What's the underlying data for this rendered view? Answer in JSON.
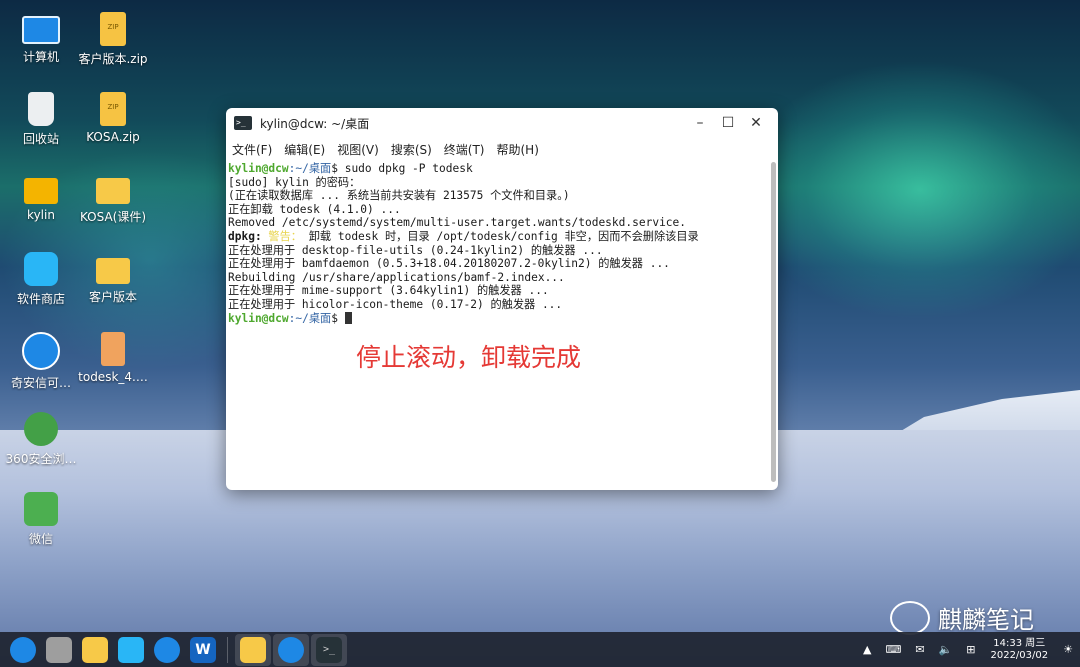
{
  "desktop_icons": [
    {
      "id": "computer",
      "label": "计算机",
      "icon": "computer-icon"
    },
    {
      "id": "trash",
      "label": "回收站",
      "icon": "trash-icon"
    },
    {
      "id": "kylin",
      "label": "kylin",
      "icon": "home-folder-icon"
    },
    {
      "id": "store",
      "label": "软件商店",
      "icon": "store-icon"
    },
    {
      "id": "qax",
      "label": "奇安信可…",
      "icon": "browser-icon"
    },
    {
      "id": "360",
      "label": "360安全浏…",
      "icon": "360-browser-icon"
    },
    {
      "id": "wechat",
      "label": "微信",
      "icon": "wechat-icon"
    },
    {
      "id": "clientzip",
      "label": "客户版本.zip",
      "icon": "zip-icon"
    },
    {
      "id": "kosazip",
      "label": "KOSA.zip",
      "icon": "zip-icon"
    },
    {
      "id": "kosafolder",
      "label": "KOSA(课件)",
      "icon": "folder-icon"
    },
    {
      "id": "clientfolder",
      "label": "客户版本",
      "icon": "folder-icon"
    },
    {
      "id": "todesk",
      "label": "todesk_4.…",
      "icon": "deb-package-icon"
    }
  ],
  "window": {
    "title": "kylin@dcw: ~/桌面",
    "menu": [
      "文件(F)",
      "编辑(E)",
      "视图(V)",
      "搜索(S)",
      "终端(T)",
      "帮助(H)"
    ],
    "prompt_user": "kylin@dcw",
    "prompt_path": ":~/桌面",
    "prompt_sign": "$",
    "command": " sudo dpkg -P todesk",
    "lines": [
      "[sudo] kylin 的密码：",
      "(正在读取数据库 ... 系统当前共安装有 213575 个文件和目录。)",
      "正在卸载 todesk (4.1.0) ...",
      "Removed /etc/systemd/system/multi-user.target.wants/todeskd.service."
    ],
    "warn_prefix": "dpkg:",
    "warn_label": " 警告：",
    "warn_text": " 卸载 todesk 时，目录 /opt/todesk/config 非空，因而不会删除该目录",
    "lines2": [
      "正在处理用于 desktop-file-utils (0.24-1kylin2) 的触发器 ...",
      "正在处理用于 bamfdaemon (0.5.3+18.04.20180207.2-0kylin2) 的触发器 ...",
      "Rebuilding /usr/share/applications/bamf-2.index...",
      "正在处理用于 mime-support (3.64kylin1) 的触发器 ...",
      "正在处理用于 hicolor-icon-theme (0.17-2) 的触发器 ..."
    ]
  },
  "annotation": "停止滚动，卸载完成",
  "watermark": "麒麟笔记",
  "taskbar": {
    "time": "14:33 周三",
    "date": "2022/03/02"
  }
}
